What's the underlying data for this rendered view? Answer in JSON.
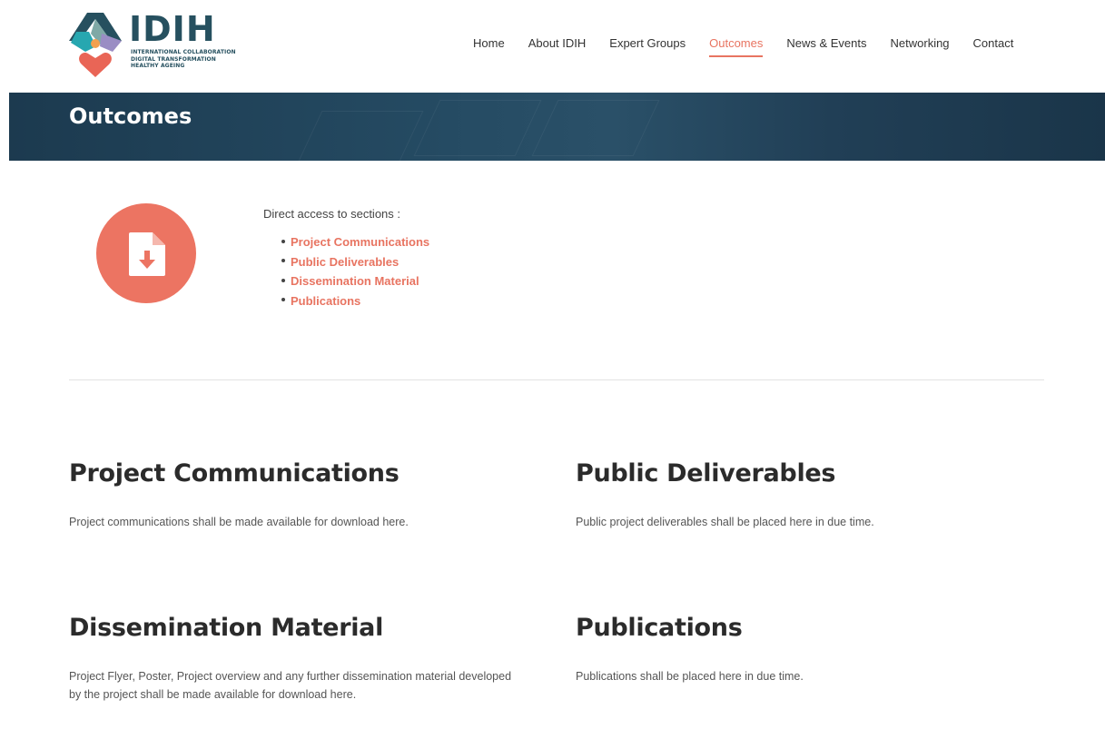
{
  "logo": {
    "word": "IDIH",
    "tagline_1": "INTERNATIONAL COLLABORATION",
    "tagline_2": "DIGITAL TRANSFORMATION",
    "tagline_3": "HEALTHY AGEING"
  },
  "nav": {
    "items": [
      {
        "label": "Home"
      },
      {
        "label": "About IDIH"
      },
      {
        "label": "Expert Groups"
      },
      {
        "label": "Outcomes"
      },
      {
        "label": "News & Events"
      },
      {
        "label": "Networking"
      },
      {
        "label": "Contact"
      }
    ],
    "active_index": 3
  },
  "banner": {
    "title": "Outcomes"
  },
  "intro": {
    "lead": "Direct access to sections :",
    "links": [
      {
        "label": "Project Communications"
      },
      {
        "label": "Public Deliverables"
      },
      {
        "label": "Dissemination Material"
      },
      {
        "label": "Publications"
      }
    ]
  },
  "sections": [
    {
      "title": "Project Communications",
      "text": "Project communications shall be made available for download here."
    },
    {
      "title": "Public Deliverables",
      "text": "Public project deliverables shall be placed here in due time."
    },
    {
      "title": "Dissemination Material",
      "text": "Project Flyer, Poster, Project overview and any further dissemination material developed by the project shall be made available for download here."
    },
    {
      "title": "Publications",
      "text": "Publications shall be placed here in due time."
    }
  ],
  "colors": {
    "accent": "#e87461",
    "banner": "#1f4157",
    "logo_dark": "#26505f"
  },
  "icons": {
    "outcomes_icon": "file-download-icon"
  }
}
